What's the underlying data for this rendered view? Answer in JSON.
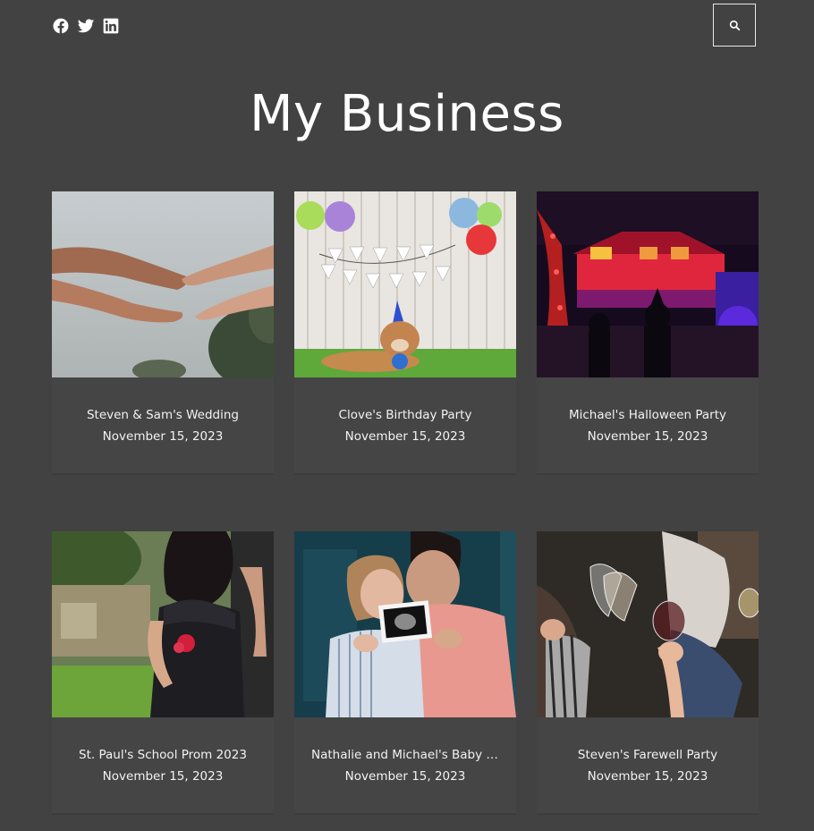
{
  "header": {
    "social_icons": [
      "facebook-icon",
      "twitter-icon",
      "linkedin-icon"
    ],
    "search_icon": "search-icon"
  },
  "site_title": "My Business",
  "posts": [
    {
      "title": "Steven & Sam's Wedding",
      "date": "November 15, 2023",
      "image": "hands-reaching"
    },
    {
      "title": "Clove's Birthday Party",
      "date": "November 15, 2023",
      "image": "dog-birthday-banner"
    },
    {
      "title": "Michael's Halloween Party",
      "date": "November 15, 2023",
      "image": "halloween-house-lights"
    },
    {
      "title": "St. Paul's School Prom 2023",
      "date": "November 15, 2023",
      "image": "prom-couple"
    },
    {
      "title": "Nathalie and Michael's Baby S...",
      "date": "November 15, 2023",
      "image": "couple-ultrasound"
    },
    {
      "title": "Steven's Farewell Party",
      "date": "November 15, 2023",
      "image": "wine-toast"
    }
  ],
  "colors": {
    "background": "#424242",
    "card_body": "#454545",
    "text": "#ffffff"
  }
}
